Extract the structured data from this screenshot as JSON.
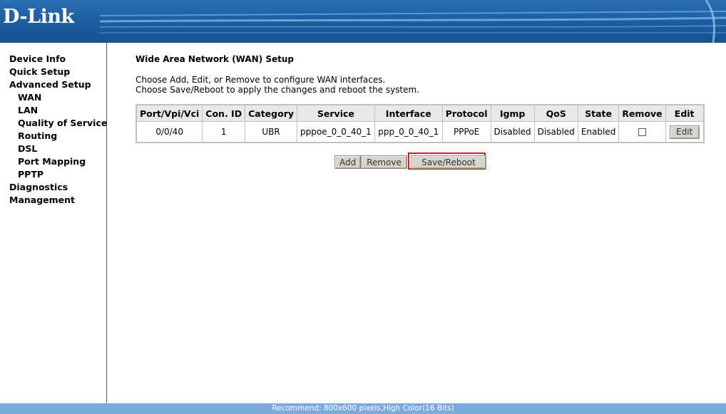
{
  "header": {
    "logo_text": "D-Link",
    "brand_color": "#1d5fa3"
  },
  "sidebar": {
    "items": [
      {
        "label": "Device Info",
        "level": 0
      },
      {
        "label": "Quick Setup",
        "level": 0
      },
      {
        "label": "Advanced Setup",
        "level": 0
      },
      {
        "label": "WAN",
        "level": 1
      },
      {
        "label": "LAN",
        "level": 1
      },
      {
        "label": "Quality of Service",
        "level": 1
      },
      {
        "label": "Routing",
        "level": 1
      },
      {
        "label": "DSL",
        "level": 1
      },
      {
        "label": "Port Mapping",
        "level": 1
      },
      {
        "label": "PPTP",
        "level": 1
      },
      {
        "label": "Diagnostics",
        "level": 0
      },
      {
        "label": "Management",
        "level": 0
      }
    ]
  },
  "main": {
    "title": "Wide Area Network (WAN) Setup",
    "instructions": [
      "Choose Add, Edit, or Remove to configure WAN interfaces.",
      "Choose Save/Reboot to apply the changes and reboot the system."
    ],
    "table": {
      "columns": [
        "Port/Vpi/Vci",
        "Con. ID",
        "Category",
        "Service",
        "Interface",
        "Protocol",
        "Igmp",
        "QoS",
        "State",
        "Remove",
        "Edit"
      ],
      "rows": [
        {
          "port": "0/0/40",
          "con_id": "1",
          "category": "UBR",
          "service": "pppoe_0_0_40_1",
          "interface": "ppp_0_0_40_1",
          "protocol": "PPPoE",
          "igmp": "Disabled",
          "qos": "Disabled",
          "state": "Enabled",
          "remove_checked": false,
          "edit_label": "Edit"
        }
      ]
    },
    "buttons": {
      "add": "Add",
      "remove": "Remove",
      "save_reboot": "Save/Reboot"
    },
    "highlight_color": "#d81e1e"
  },
  "footer": {
    "text": "Recommend: 800x600 pixels,High Color(16 Bits)"
  }
}
